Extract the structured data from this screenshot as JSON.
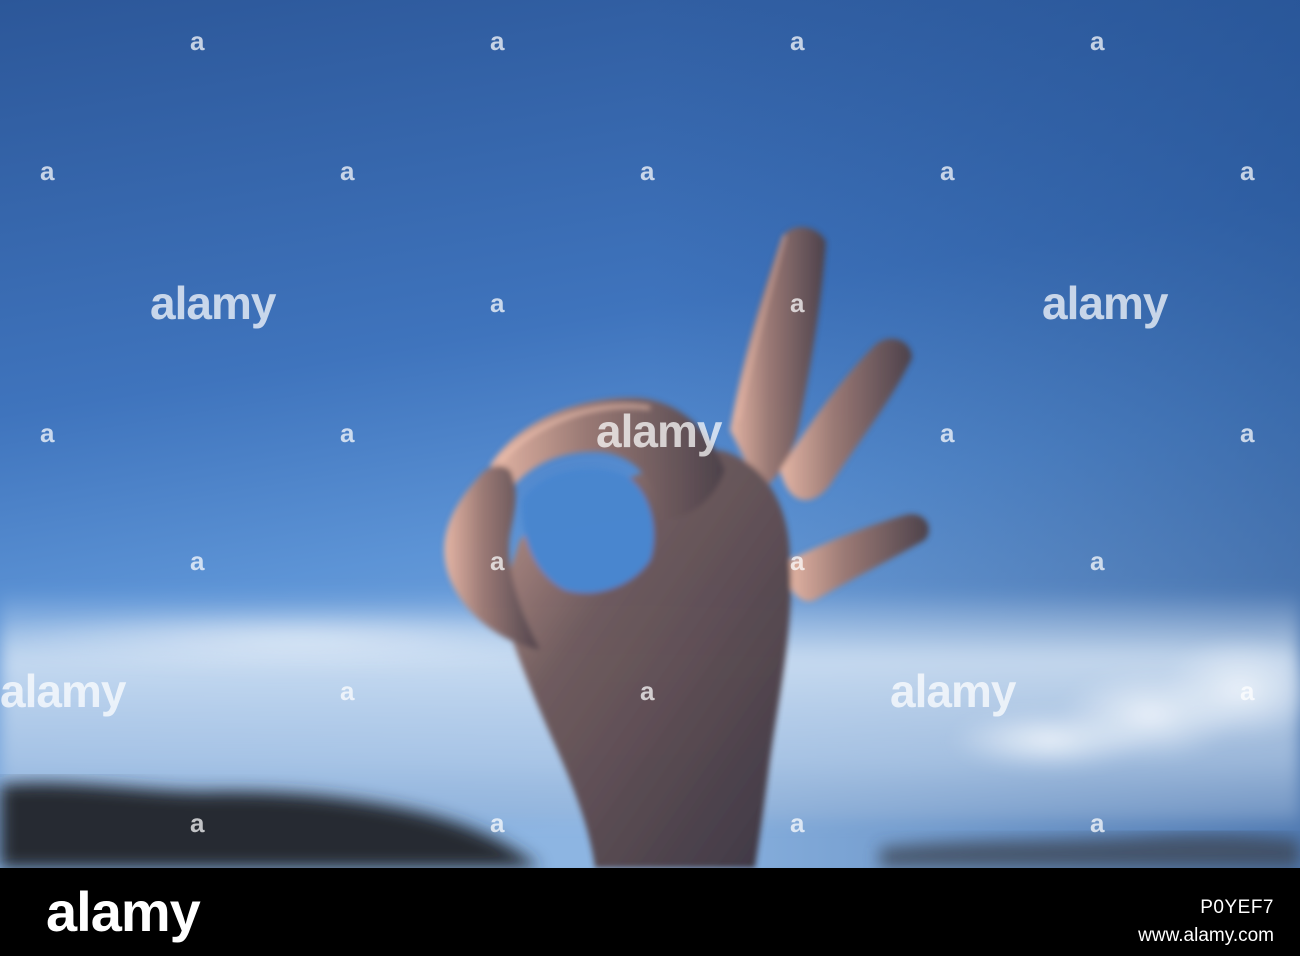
{
  "watermark": {
    "word": "alamy",
    "mark": "a"
  },
  "footer": {
    "logo": "alamy",
    "image_id": "P0YEF7",
    "url": "www.alamy.com"
  }
}
